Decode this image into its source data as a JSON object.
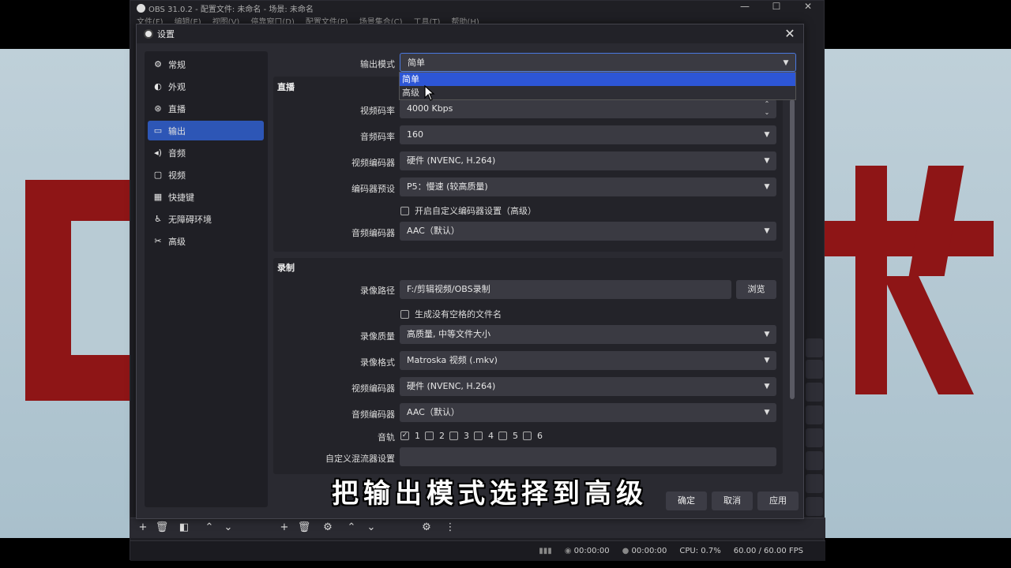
{
  "obs_window": {
    "title": "OBS 31.0.2 - 配置文件: 未命名 - 场景: 未命名",
    "menu": [
      "文件(F)",
      "编辑(E)",
      "视图(V)",
      "停靠窗口(D)",
      "配置文件(P)",
      "场景集合(C)",
      "工具(T)",
      "帮助(H)"
    ],
    "status": {
      "net_time": "00:00:00",
      "rec_time": "00:00:00",
      "cpu": "CPU: 0.7%",
      "fps": "60.00 / 60.00 FPS"
    }
  },
  "dialog": {
    "title": "设置",
    "sidebar": [
      {
        "label": "常规",
        "icon": "gear-icon"
      },
      {
        "label": "外观",
        "icon": "palette-icon"
      },
      {
        "label": "直播",
        "icon": "broadcast-icon"
      },
      {
        "label": "输出",
        "icon": "output-icon",
        "active": true
      },
      {
        "label": "音频",
        "icon": "speaker-icon"
      },
      {
        "label": "视频",
        "icon": "monitor-icon"
      },
      {
        "label": "快捷键",
        "icon": "keyboard-icon"
      },
      {
        "label": "无障碍环境",
        "icon": "accessibility-icon"
      },
      {
        "label": "高级",
        "icon": "tools-icon"
      }
    ],
    "output_mode": {
      "label": "输出模式",
      "value": "简单",
      "options": [
        "简单",
        "高级"
      ],
      "highlighted": "简单"
    },
    "streaming": {
      "title": "直播",
      "video_bitrate": {
        "label": "视频码率",
        "value": "4000 Kbps"
      },
      "audio_bitrate": {
        "label": "音频码率",
        "value": "160"
      },
      "video_encoder": {
        "label": "视频编码器",
        "value": "硬件 (NVENC, H.264)"
      },
      "encoder_preset": {
        "label": "编码器预设",
        "value": "P5：慢速 (较高质量)"
      },
      "custom_encoder": {
        "label": "开启自定义编码器设置（高级）",
        "checked": false
      },
      "audio_encoder": {
        "label": "音频编码器",
        "value": "AAC（默认）"
      }
    },
    "recording": {
      "title": "录制",
      "path": {
        "label": "录像路径",
        "value": "F:/剪辑视频/OBS录制",
        "browse": "浏览"
      },
      "no_space": {
        "label": "生成没有空格的文件名",
        "checked": false
      },
      "quality": {
        "label": "录像质量",
        "value": "高质量, 中等文件大小"
      },
      "format": {
        "label": "录像格式",
        "value": "Matroska 视频 (.mkv)"
      },
      "video_encoder": {
        "label": "视频编码器",
        "value": "硬件 (NVENC, H.264)"
      },
      "audio_encoder": {
        "label": "音频编码器",
        "value": "AAC（默认）"
      },
      "tracks": {
        "label": "音轨",
        "items": [
          {
            "n": "1",
            "checked": true
          },
          {
            "n": "2",
            "checked": false
          },
          {
            "n": "3",
            "checked": false
          },
          {
            "n": "4",
            "checked": false
          },
          {
            "n": "5",
            "checked": false
          },
          {
            "n": "6",
            "checked": false
          }
        ]
      },
      "muxer": {
        "label": "自定义混流器设置",
        "value": ""
      }
    },
    "buttons": {
      "ok": "确定",
      "cancel": "取消",
      "apply": "应用"
    }
  },
  "caption": "把输出模式选择到高级",
  "colors": {
    "accent": "#2d56b6",
    "dropdown_highlight": "#2d56d6",
    "bg_red": "#8e1516"
  }
}
